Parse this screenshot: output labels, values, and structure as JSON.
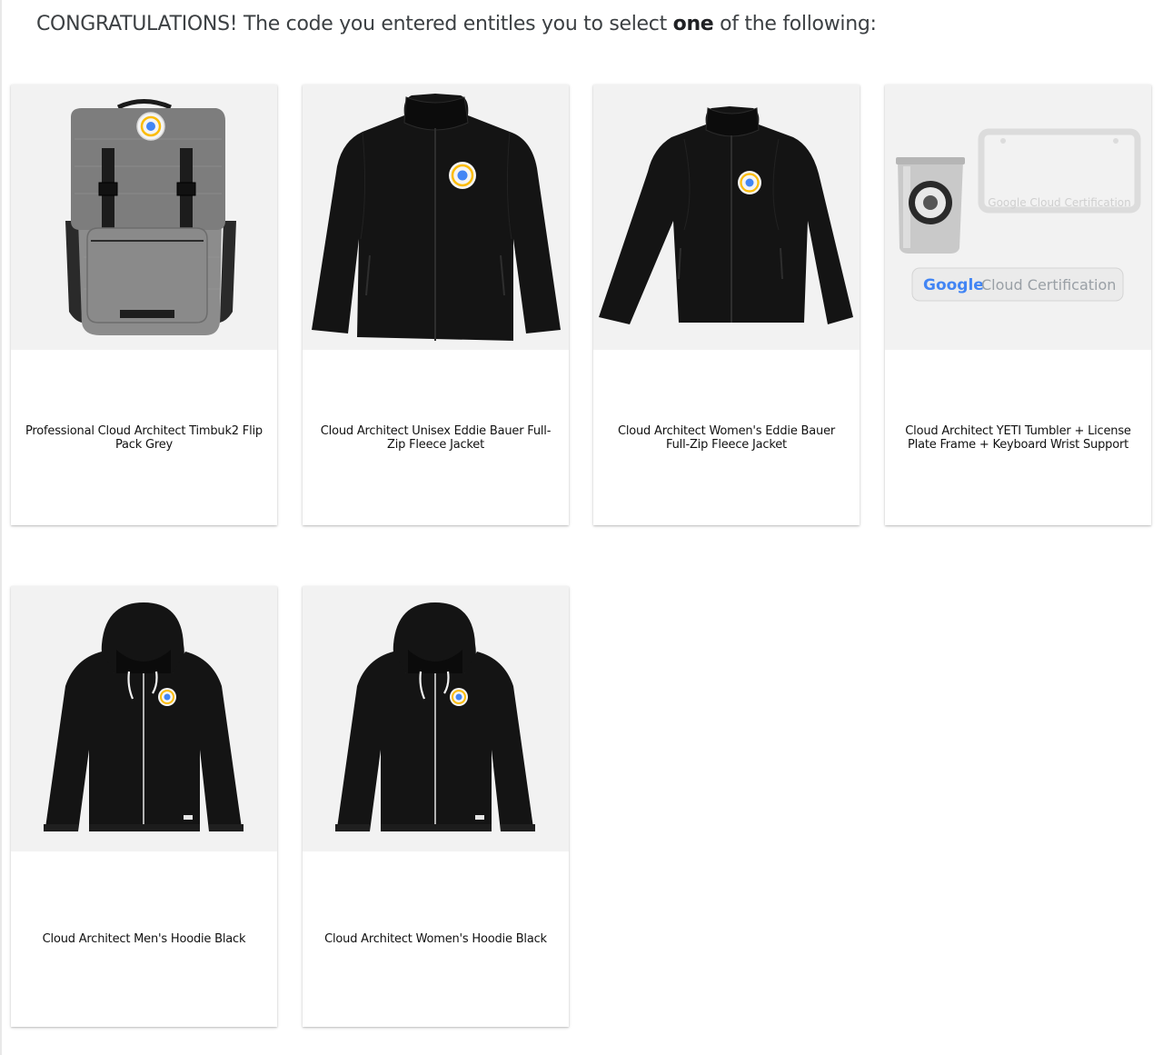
{
  "heading": {
    "prefix": "CONGRATULATIONS! The code you entered entitles you to select ",
    "emphasis": "one",
    "suffix": " of the following:"
  },
  "products": [
    {
      "label": "Professional Cloud Architect Timbuk2 Flip Pack Grey",
      "icon": "backpack-image"
    },
    {
      "label": "Cloud Architect Unisex Eddie Bauer Full-Zip Fleece Jacket",
      "icon": "jacket-image"
    },
    {
      "label": "Cloud Architect Women's Eddie Bauer Full-Zip Fleece Jacket",
      "icon": "jacket-image"
    },
    {
      "label": "Cloud Architect YETI Tumbler + License Plate Frame + Keyboard Wrist Support",
      "icon": "bundle-image"
    },
    {
      "label": "Cloud Architect Men's Hoodie Black",
      "icon": "hoodie-image"
    },
    {
      "label": "Cloud Architect Women's Hoodie Black",
      "icon": "hoodie-image"
    }
  ],
  "image_text": {
    "plate_frame": "Google Cloud Certification",
    "wrist_brand": "Google",
    "wrist_text": "Cloud Certification"
  },
  "colors": {
    "image_background": "#f2f2f2",
    "garment_black": "#141414",
    "backpack_grey": "#8a8a8a",
    "google_blue": "#4285F4",
    "google_red": "#EA4335",
    "google_yellow": "#FBBC05",
    "google_green": "#34A853"
  }
}
